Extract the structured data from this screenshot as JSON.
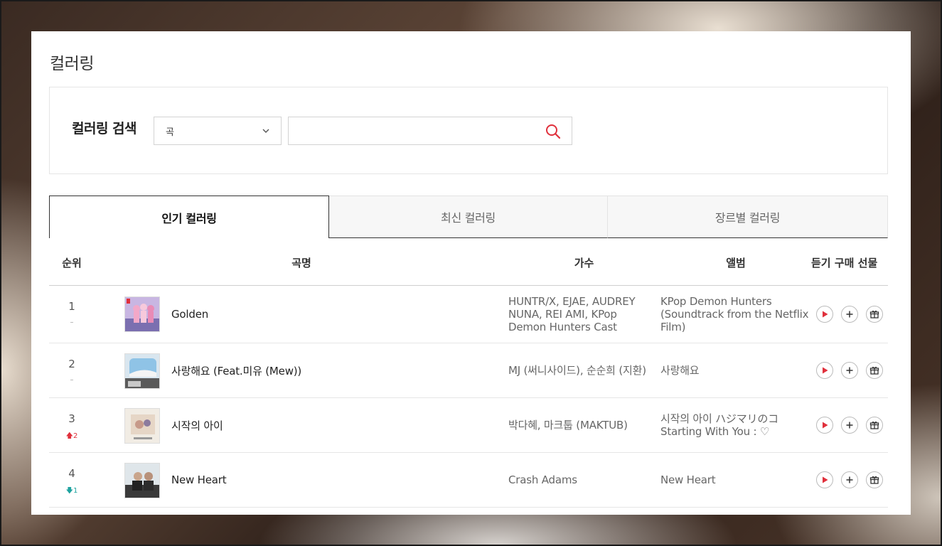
{
  "page": {
    "title": "컬러링"
  },
  "search": {
    "label": "컬러링 검색",
    "select_value": "곡",
    "input_value": "",
    "input_placeholder": ""
  },
  "tabs": [
    {
      "label": "인기 컬러링",
      "active": true
    },
    {
      "label": "최신 컬러링",
      "active": false
    },
    {
      "label": "장르별 컬러링",
      "active": false
    }
  ],
  "table": {
    "headers": {
      "rank": "순위",
      "song": "곡명",
      "artist": "가수",
      "album": "앨범",
      "actions": "듣기 구매 선물"
    },
    "rows": [
      {
        "rank": "1",
        "change_dir": "same",
        "change_text": "–",
        "change_value": "",
        "song": "Golden",
        "artist": "HUNTR/X, EJAE, AUDREY NUNA, REI AMI, KPop Demon Hunters Cast",
        "album": "KPop Demon Hunters (Soundtrack from the Netflix Film)"
      },
      {
        "rank": "2",
        "change_dir": "same",
        "change_text": "–",
        "change_value": "",
        "song": "사랑해요 (Feat.미유 (Mew))",
        "artist": "MJ (써니사이드), 순순희 (지환)",
        "album": "사랑해요"
      },
      {
        "rank": "3",
        "change_dir": "up",
        "change_text": "",
        "change_value": "2",
        "song": "시작의 아이",
        "artist": "박다혜, 마크툽 (MAKTUB)",
        "album": "시작의 아이 ハジマリのコ Starting With You : ♡"
      },
      {
        "rank": "4",
        "change_dir": "down",
        "change_text": "",
        "change_value": "1",
        "song": "New Heart",
        "artist": "Crash Adams",
        "album": "New Heart"
      }
    ]
  },
  "icons": {
    "select": "chevron-down-icon",
    "search": "search-icon",
    "play": "play-icon",
    "add": "plus-icon",
    "gift": "gift-icon"
  },
  "colors": {
    "accent": "#e0303c",
    "up": "#e0303c",
    "down": "#1fa3a0"
  }
}
